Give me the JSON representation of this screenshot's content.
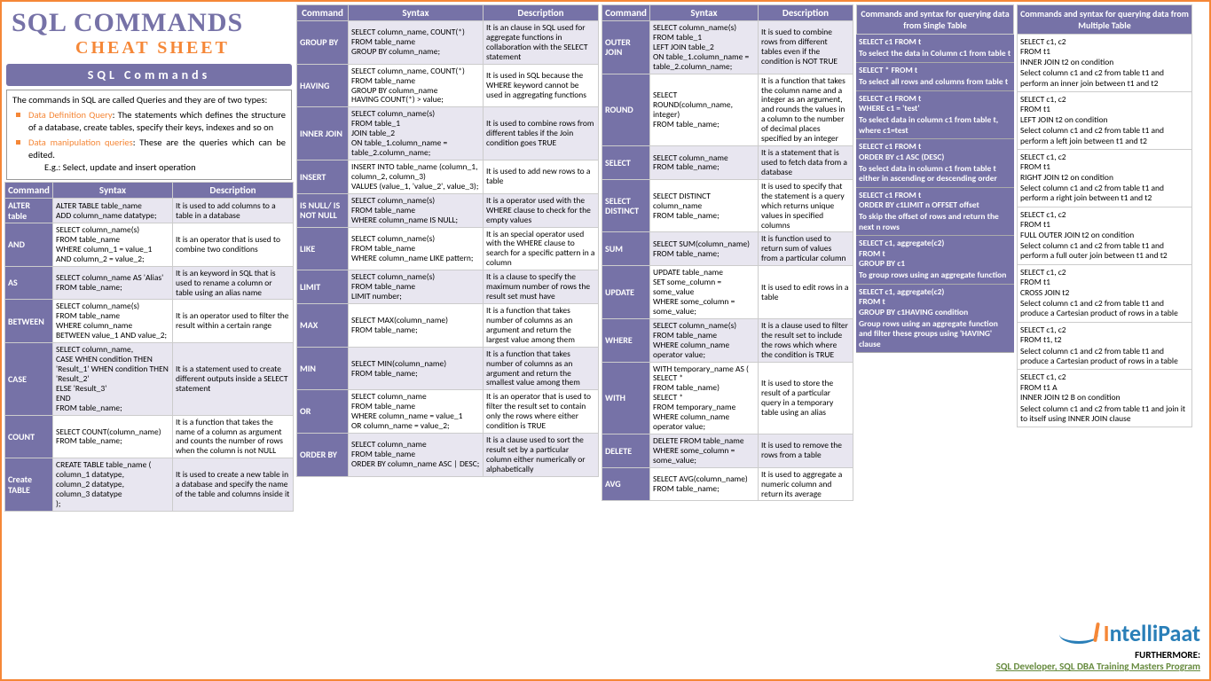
{
  "title": "SQL COMMANDS",
  "subtitle": "CHEAT SHEET",
  "section_header": "SQL Commands",
  "intro_lead": "The commands in SQL are called Queries and they are of two types:",
  "intro_b1_term": "Data Definition Query",
  "intro_b1_text": ": The statements which defines the structure of a database, create tables, specify their keys, indexes and so on",
  "intro_b2_term": "Data manipulation queries",
  "intro_b2_text": ": These are the queries which can be edited.",
  "intro_eg": "E.g.: Select, update and insert operation",
  "hdr_cmd": "Command",
  "hdr_syn": "Syntax",
  "hdr_desc": "Description",
  "t1": [
    {
      "c": "ALTER table",
      "s": "ALTER TABLE table_name\nADD column_name datatype;",
      "d": "It is used to add columns to a table in a database"
    },
    {
      "c": "AND",
      "s": "SELECT column_name(s)\nFROM table_name\nWHERE column_1 = value_1\nAND column_2 = value_2;",
      "d": "It is an operator that is used to combine two conditions"
    },
    {
      "c": "AS",
      "s": "SELECT column_name AS 'Alias'\nFROM table_name;",
      "d": "It is an keyword in SQL that is used to rename a column or table using an alias name"
    },
    {
      "c": "BETWEEN",
      "s": "SELECT column_name(s)\nFROM table_name\nWHERE column_name\nBETWEEN value_1 AND value_2;",
      "d": "It is an operator used to filter the result within a certain range"
    },
    {
      "c": "CASE",
      "s": "SELECT column_name,\nCASE   WHEN condition THEN 'Result_1'   WHEN condition THEN 'Result_2'\nELSE 'Result_3'\nEND\nFROM table_name;",
      "d": "It is a statement used to create different outputs inside a SELECT statement"
    },
    {
      "c": "COUNT",
      "s": "SELECT COUNT(column_name)\nFROM table_name;",
      "d": "It is a function that takes the name of a column as argument and counts the number of rows when the column is not NULL"
    },
    {
      "c": "Create TABLE",
      "s": "CREATE TABLE table_name (\ncolumn_1 datatype,\ncolumn_2 datatype,\ncolumn_3 datatype\n);",
      "d": "It is used to create a new table in a database and specify the name of the table and columns inside it"
    }
  ],
  "t2": [
    {
      "c": "GROUP BY",
      "s": "SELECT column_name, COUNT(*)\nFROM table_name\nGROUP BY column_name;",
      "d": "It is an clause in SQL used for aggregate functions in collaboration with the SELECT statement"
    },
    {
      "c": "HAVING",
      "s": "SELECT column_name, COUNT(*)\nFROM table_name\nGROUP BY column_name\nHAVING COUNT(*) > value;",
      "d": "It is used in SQL because the WHERE keyword cannot be used in aggregating functions"
    },
    {
      "c": "INNER JOIN",
      "s": "SELECT column_name(s)\nFROM table_1\nJOIN table_2\nON table_1.column_name = table_2.column_name;",
      "d": "It is used to combine rows from different tables if the Join condition goes TRUE"
    },
    {
      "c": "INSERT",
      "s": "INSERT INTO table_name (column_1, column_2, column_3)\nVALUES (value_1, 'value_2', value_3);",
      "d": "It is used to add new rows to a table"
    },
    {
      "c": "IS NULL/ IS NOT NULL",
      "s": "SELECT column_name(s)\nFROM table_name\nWHERE column_name IS NULL;",
      "d": "It is a operator used with the WHERE clause to check for the empty values"
    },
    {
      "c": "LIKE",
      "s": "SELECT column_name(s)\nFROM table_name\nWHERE column_name LIKE pattern;",
      "d": "It is an special operator used with the WHERE clause to search for a specific pattern in a column"
    },
    {
      "c": "LIMIT",
      "s": "SELECT column_name(s)\nFROM table_name\nLIMIT number;",
      "d": "It is a clause to specify the maximum number of rows the result set must have"
    },
    {
      "c": "MAX",
      "s": "SELECT MAX(column_name)\nFROM table_name;",
      "d": "It is a function that takes number of columns as an argument and return the largest value among them"
    },
    {
      "c": "MIN",
      "s": "SELECT MIN(column_name)\nFROM table_name;",
      "d": "It is a function that takes number of columns as an argument and return the smallest value among them"
    },
    {
      "c": "OR",
      "s": "SELECT column_name\nFROM table_name\nWHERE column_name = value_1\nOR column_name = value_2;",
      "d": "It is an operator that is used to filter the result set to contain only the rows where either condition is TRUE"
    },
    {
      "c": "ORDER BY",
      "s": "SELECT column_name\nFROM table_name\nORDER BY column_name ASC | DESC;",
      "d": "It is a clause used to sort the result set by a particular column either numerically or alphabetically"
    }
  ],
  "t3": [
    {
      "c": "OUTER JOIN",
      "s": "SELECT column_name(s)\nFROM table_1\nLEFT JOIN table_2\nON table_1.column_name = table_2.column_name;",
      "d": "It is sued to combine rows from different tables even if the condition is NOT TRUE"
    },
    {
      "c": "ROUND",
      "s": "SELECT ROUND(column_name, integer)\nFROM table_name;",
      "d": "It is a function that takes the column name and a integer as an argument, and rounds the values in a column to the number of decimal places specified by an integer"
    },
    {
      "c": "SELECT",
      "s": "SELECT column_name\nFROM table_name;",
      "d": "It is a statement that is used to fetch data from a database"
    },
    {
      "c": "SELECT DISTINCT",
      "s": "SELECT DISTINCT column_name\nFROM table_name;",
      "d": "It is used to specify that the statement is a query which returns unique values in specified columns"
    },
    {
      "c": "SUM",
      "s": "SELECT SUM(column_name)\nFROM table_name;",
      "d": "It is function used to return sum of values from a particular column"
    },
    {
      "c": "UPDATE",
      "s": "UPDATE table_name\nSET some_column = some_value\nWHERE some_column = some_value;",
      "d": "It is used to edit rows in a table"
    },
    {
      "c": "WHERE",
      "s": "SELECT column_name(s)\nFROM table_name\nWHERE column_name operator value;",
      "d": "It is a clause used to filter the result set to include the rows which where the condition is TRUE"
    },
    {
      "c": "WITH",
      "s": "WITH temporary_name AS (\nSELECT *\nFROM table_name)\nSELECT *\nFROM temporary_name\nWHERE column_name operator value;",
      "d": "It is used to store the result of a particular query in a temporary table using an alias"
    },
    {
      "c": "DELETE",
      "s": "DELETE FROM table_name\nWHERE some_column = some_value;",
      "d": "It is used to remove the rows from a table"
    },
    {
      "c": "AVG",
      "s": "SELECT AVG(column_name)\nFROM table_name;",
      "d": "It is used to aggregate a numeric column and return its average"
    }
  ],
  "q4hdr": "Commands and syntax for querying data from Single Table",
  "q5hdr": "Commands and syntax for querying data from Multiple Table",
  "q4": [
    {
      "a": "SELECT c1 FROM t",
      "b": "To select the data in Column c1 from table t"
    },
    {
      "a": "SELECT * FROM t",
      "b": "To select all rows and columns from table t"
    },
    {
      "a": "SELECT c1 FROM t\nWHERE c1 = 'test'",
      "b": "To select data in column c1 from table t, where c1=test"
    },
    {
      "a": "SELECT c1 FROM t\nORDER BY c1 ASC (DESC)",
      "b": "To select data in column c1 from table t either in ascending or descending order"
    },
    {
      "a": "SELECT c1 FROM t\nORDER BY c1LIMIT n OFFSET offset",
      "b": "To skip the offset of rows and return the next n rows"
    },
    {
      "a": "SELECT c1, aggregate(c2)\nFROM t\nGROUP BY c1",
      "b": "To group rows using an aggregate function"
    },
    {
      "a": "SELECT c1, aggregate(c2)\nFROM t\nGROUP BY c1HAVING condition",
      "b": "Group rows using an aggregate function and filter these groups using 'HAVING' clause"
    }
  ],
  "q5": [
    {
      "a": "SELECT c1, c2\nFROM t1\nINNER JOIN t2 on condition",
      "b": "Select column c1 and c2 from table t1 and perform an inner join between t1 and t2"
    },
    {
      "a": "SELECT c1, c2\nFROM t1\nLEFT JOIN t2 on condition",
      "b": "Select column c1 and c2 from table t1 and perform a left join between t1 and t2"
    },
    {
      "a": "SELECT c1, c2\nFROM t1\nRIGHT JOIN t2 on condition",
      "b": "Select column c1 and c2 from table t1 and perform a right join between t1 and t2"
    },
    {
      "a": "SELECT c1, c2\nFROM t1\nFULL OUTER JOIN t2 on condition",
      "b": "Select column c1 and c2 from table t1 and perform a full outer join between t1 and t2"
    },
    {
      "a": "SELECT c1, c2\nFROM t1\nCROSS JOIN t2",
      "b": "Select column c1 and c2 from table t1 and produce a Cartesian product of rows in a table"
    },
    {
      "a": "SELECT c1, c2\nFROM t1, t2",
      "b": "Select column c1 and c2 from table t1 and produce a Cartesian product of rows in a table"
    },
    {
      "a": "SELECT c1, c2\nFROM t1 A\nINNER JOIN t2 B on condition",
      "b": "Select column c1 and c2 from table t1 and join it to itself using INNER JOIN clause"
    }
  ],
  "logo": "ntelliPaat",
  "fur": "FURTHERMORE:",
  "link": "SQL Developer, SQL DBA Training Masters Program"
}
